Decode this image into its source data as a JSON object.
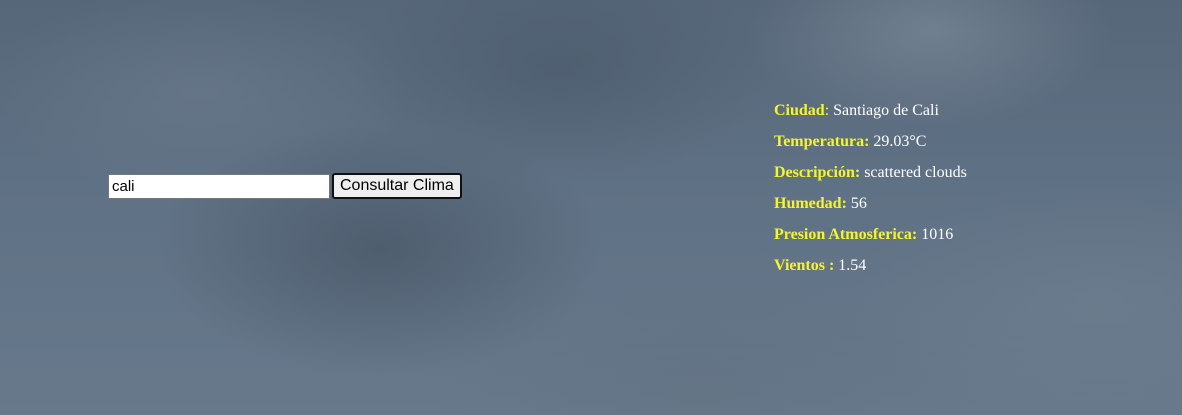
{
  "search": {
    "value": "cali",
    "button_label": "Consultar Clima"
  },
  "weather": {
    "city_label": "Ciudad",
    "city_sep": ":",
    "city_value": " Santiago de Cali",
    "temp_label": "Temperatura:",
    "temp_value": " 29.03°C",
    "desc_label": "Descripción:",
    "desc_value": " scattered clouds",
    "humidity_label": "Humedad:",
    "humidity_value": " 56",
    "pressure_label": "Presion Atmosferica:",
    "pressure_value": " 1016",
    "wind_label": "Vientos :",
    "wind_value": " 1.54"
  },
  "colors": {
    "label": "#f5f52a",
    "value": "#ffffff",
    "background": "#5f7184"
  }
}
